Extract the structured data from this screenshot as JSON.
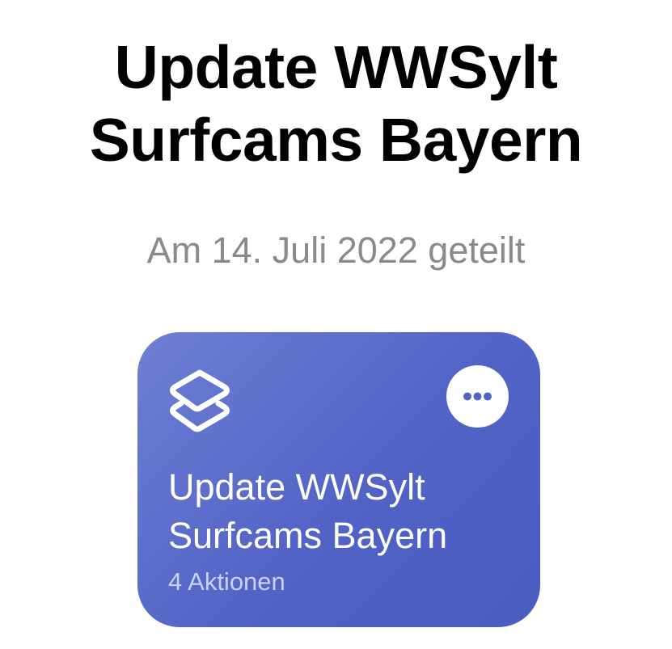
{
  "header": {
    "title_line1": "Update WWSylt",
    "title_line2": "Surfcams Bayern",
    "shared_date": "Am 14. Juli 2022 geteilt"
  },
  "shortcut_card": {
    "icon": "shortcuts-layers-icon",
    "more_icon": "ellipsis-icon",
    "title_line1": "Update WWSylt",
    "title_line2": "Surfcams Bayern",
    "action_count": "4 Aktionen",
    "colors": {
      "gradient_start": "#6e7fd3",
      "gradient_end": "#4a5cc0",
      "subtitle": "#c9d2f5"
    }
  }
}
